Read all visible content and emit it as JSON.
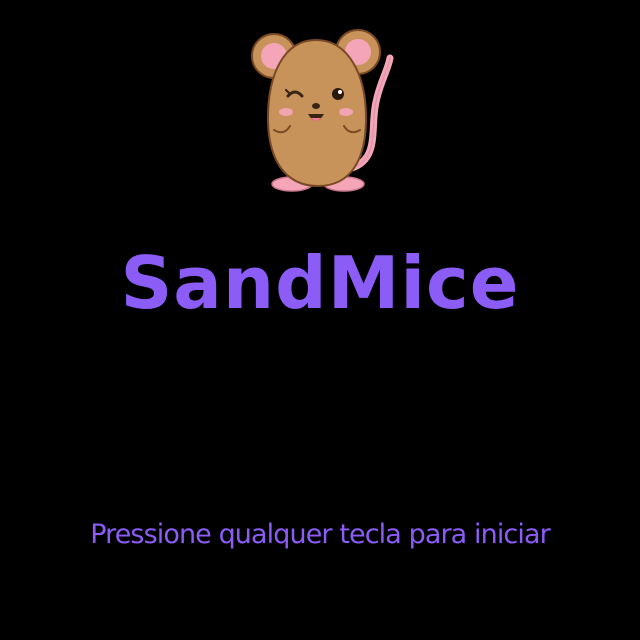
{
  "game": {
    "title": "SandMice",
    "start_prompt": "Pressione qualquer tecla para iniciar"
  },
  "colors": {
    "background": "#000000",
    "accent": "#8b5cf6",
    "mouse_body": "#c8935a",
    "mouse_outline": "#7a4a24",
    "mouse_pink": "#f4a6b8"
  },
  "mascot": {
    "icon": "mouse-mascot-icon"
  }
}
